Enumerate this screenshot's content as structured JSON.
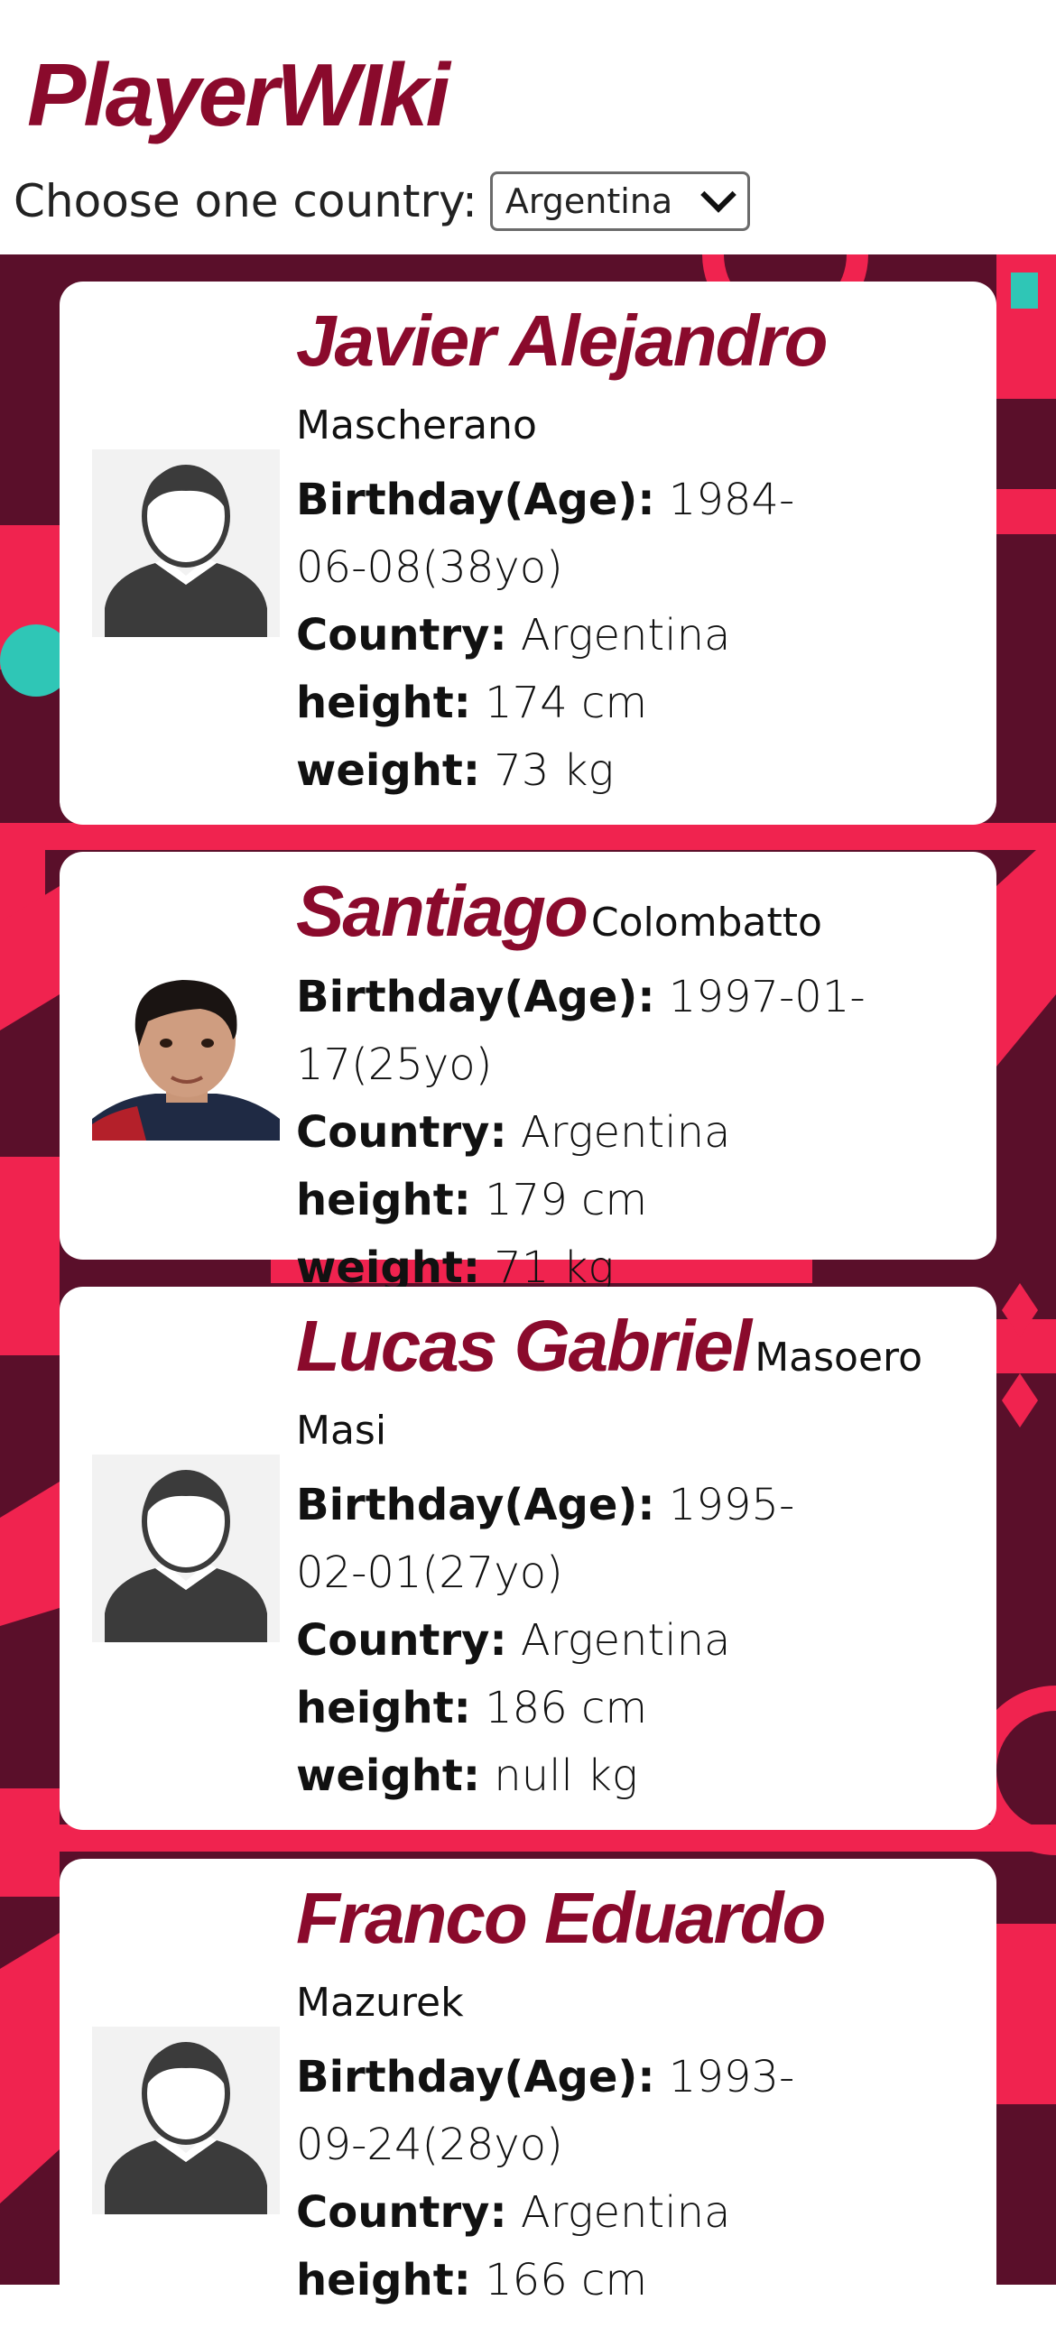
{
  "header": {
    "title": "PlayerWIki",
    "country_label": "Choose one country:",
    "country_selected": "Argentina"
  },
  "labels": {
    "birthday": "Birthday(Age):",
    "country": "Country:",
    "height": "height:",
    "weight": "weight:"
  },
  "players": [
    {
      "first_name": "Javier Alejandro",
      "last_name": "Mascherano",
      "birthday": "1984-06-08(38yo)",
      "country": "Argentina",
      "height": "174 cm",
      "weight": "73 kg",
      "photo": "default-avatar-icon"
    },
    {
      "first_name": "Santiago",
      "last_name": "Colombatto",
      "birthday": "1997-01-17(25yo)",
      "country": "Argentina",
      "height": "179 cm",
      "weight": "71 kg",
      "photo": "player-photo"
    },
    {
      "first_name": "Lucas Gabriel",
      "last_name": "Masoero Masi",
      "birthday": "1995-02-01(27yo)",
      "country": "Argentina",
      "height": "186 cm",
      "weight": "null kg",
      "photo": "default-avatar-icon"
    },
    {
      "first_name": "Franco Eduardo",
      "last_name": "Mazurek",
      "birthday": "1993-09-24(28yo)",
      "country": "Argentina",
      "height": "166 cm",
      "weight": "",
      "photo": "default-avatar-icon"
    }
  ],
  "colors": {
    "brand": "#8a0a2c",
    "background_dark": "#5a0f2a",
    "background_accent": "#f0234f",
    "teal_accent": "#2fc6b6"
  }
}
